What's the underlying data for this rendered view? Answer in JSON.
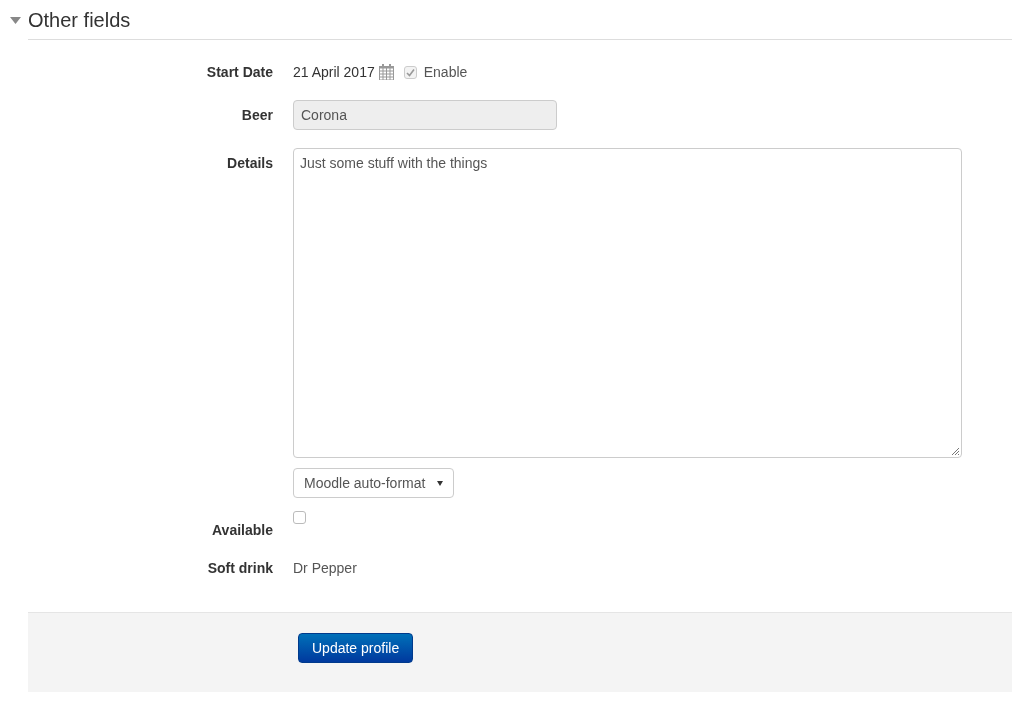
{
  "section": {
    "title": "Other fields",
    "expanded": true
  },
  "fields": [
    {
      "kind": "date",
      "label": "Start Date",
      "value": "21 April 2017",
      "enable_label": "Enable",
      "enable_checked": true,
      "enable_disabled": true
    },
    {
      "kind": "text",
      "label": "Beer",
      "value": "Corona",
      "disabled": true
    },
    {
      "kind": "textarea",
      "label": "Details",
      "value": "Just some stuff with the things",
      "format": "Moodle auto-format"
    },
    {
      "kind": "checkbox",
      "label": "Available",
      "checked": false
    },
    {
      "kind": "static",
      "label": "Soft drink",
      "value": "Dr Pepper"
    }
  ],
  "submit_button": "Update profile"
}
